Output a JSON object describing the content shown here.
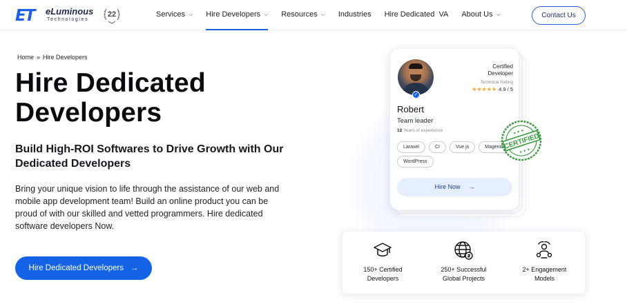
{
  "brand": {
    "mark": "ET",
    "name": "eLuminous",
    "tagline": "Technologies",
    "badge_number": "22"
  },
  "nav": {
    "items": [
      {
        "label": "Services",
        "has_dropdown": true,
        "active": false
      },
      {
        "label": "Hire Developers",
        "has_dropdown": true,
        "active": true
      },
      {
        "label": "Resources",
        "has_dropdown": true,
        "active": false
      },
      {
        "label": "Industries",
        "has_dropdown": false,
        "active": false
      },
      {
        "label": "Hire Dedicated  VA",
        "has_dropdown": false,
        "active": false
      },
      {
        "label": "About Us",
        "has_dropdown": true,
        "active": false
      }
    ],
    "contact_label": "Contact Us"
  },
  "breadcrumb": {
    "home": "Home",
    "separator": "»",
    "current": "Hire Developers"
  },
  "hero": {
    "title_line1": "Hire Dedicated",
    "title_line2": "Developers",
    "subtitle": "Build High-ROI Softwares to Drive Growth with Our Dedicated Developers",
    "description": "Bring your unique vision to life through the assistance of our web and mobile app development team! Build an online product you can be proud of with our skilled and vetted programmers. Hire dedicated software developers Now.",
    "cta_label": "Hire Dedicated Developers",
    "cta_arrow": "→"
  },
  "profile_card": {
    "certified_line1": "Certified",
    "certified_line2": "Developer",
    "rating_label": "Technical Rating",
    "rating_stars": "★★★★★",
    "rating_value": "4.9 / 5",
    "name": "Robert",
    "role": "Team leader",
    "experience_years": "12",
    "experience_label": "Years of experience",
    "skills": [
      "Laravel",
      "CI",
      "Vue js",
      "Magento",
      "WordPress"
    ],
    "hire_label": "Hire Now",
    "hire_arrow": "→",
    "stamp_text": "CERTIFIED"
  },
  "stats": [
    {
      "icon": "graduation-cap-icon",
      "line1": "150+ Certified",
      "line2": "Developers"
    },
    {
      "icon": "globe-icon",
      "line1": "250+ Successful",
      "line2": "Global Projects"
    },
    {
      "icon": "engagement-people-icon",
      "line1": "2+ Engagement",
      "line2": "Models"
    }
  ],
  "colors": {
    "primary": "#1463e6",
    "nav_active_underline": "#1d5fe0",
    "hire_now_bg": "#e6efff",
    "star": "#f5a623",
    "stamp_green": "#3a9a3e"
  }
}
